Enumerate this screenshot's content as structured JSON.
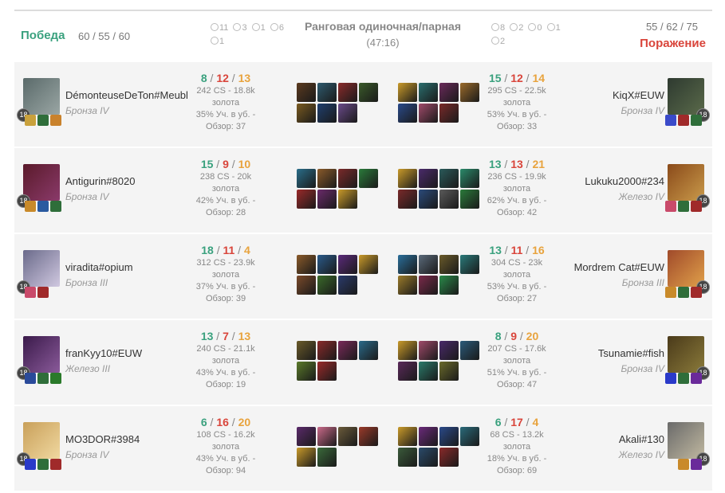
{
  "header": {
    "win_label": "Победа",
    "win_score": "60 / 55 / 60",
    "loss_label": "Поражение",
    "loss_score": "55 / 62 / 75",
    "queue_title": "Ранговая одиночная/парная",
    "duration": "(47:16)",
    "blue_objectives": {
      "towers": "11",
      "inhibitors": "3",
      "barons": "1",
      "dragons": "6",
      "heralds": "1"
    },
    "red_objectives": {
      "towers": "8",
      "inhibitors": "2",
      "barons": "0",
      "dragons": "1",
      "heralds": "2"
    }
  },
  "labels": {
    "gold": "золота"
  },
  "rows": [
    {
      "left": {
        "name": "DémonteuseDeTon#Meubl",
        "rank": "Бронза IV",
        "level": "18",
        "k": "8",
        "d": "12",
        "a": "13",
        "cs": "242 CS - 18.8k",
        "kp": "35% Уч. в уб. -",
        "vision": "Обзор: 37",
        "portrait_colors": [
          "#5a6a6a",
          "#9aa6a4"
        ],
        "rune_colors": [
          "#c9a13c",
          "#2f6e3a",
          "#c9822c"
        ],
        "item_colors": [
          "#5b3a1f",
          "#2e5a6e",
          "#8a2b2b",
          "#3a5a2a",
          "#7a5a20",
          "#1f3f6e",
          "#6a4a8a"
        ]
      },
      "right": {
        "name": "KiqX#EUW",
        "rank": "Бронза IV",
        "level": "18",
        "k": "15",
        "d": "12",
        "a": "14",
        "cs": "295 CS - 22.5k",
        "kp": "53% Уч. в уб. -",
        "vision": "Обзор: 33",
        "portrait_colors": [
          "#2e3a30",
          "#5a6a4a"
        ],
        "rune_colors": [
          "#3a4ac9",
          "#a02a2a",
          "#2f6e3a"
        ],
        "item_colors": [
          "#c99a2a",
          "#2a6e6e",
          "#6a2a5a",
          "#9a6a2a",
          "#2a4a8a",
          "#a04a6a",
          "#7a2a2a"
        ]
      }
    },
    {
      "left": {
        "name": "Antigurin#8020",
        "rank": "Бронза IV",
        "level": "18",
        "k": "15",
        "d": "9",
        "a": "10",
        "cs": "238 CS - 20k",
        "kp": "42% Уч. в уб. -",
        "vision": "Обзор: 28",
        "portrait_colors": [
          "#5a1a2a",
          "#8a3a6a"
        ],
        "rune_colors": [
          "#c98a2a",
          "#2a5aa0",
          "#2f6e3a"
        ],
        "item_colors": [
          "#2a6e8a",
          "#8a5a2a",
          "#7a2a2a",
          "#2a7a3a",
          "#9a2a2a",
          "#6a2a6a",
          "#c99a2a"
        ]
      },
      "right": {
        "name": "Lukuku2000#234",
        "rank": "Железо IV",
        "level": "18",
        "k": "13",
        "d": "13",
        "a": "21",
        "cs": "236 CS - 19.9k",
        "kp": "62% Уч. в уб. -",
        "vision": "Обзор: 42",
        "portrait_colors": [
          "#8a4a1a",
          "#c99a4a"
        ],
        "rune_colors": [
          "#c94a6a",
          "#2f6e3a",
          "#a02a2a"
        ],
        "item_colors": [
          "#c99a2a",
          "#4a2a6a",
          "#2a5a5a",
          "#2a8a6a",
          "#7a2a2a",
          "#2a4a7a",
          "#5a5a5a",
          "#2a7a3a"
        ]
      }
    },
    {
      "left": {
        "name": "viradita#opium",
        "rank": "Бронза III",
        "level": "18",
        "k": "18",
        "d": "11",
        "a": "4",
        "cs": "312 CS - 23.9k",
        "kp": "37% Уч. в уб. -",
        "vision": "Обзор: 39",
        "portrait_colors": [
          "#6a6a8a",
          "#d0c8e0"
        ],
        "rune_colors": [
          "#c94a6a",
          "#a02a2a"
        ],
        "item_colors": [
          "#8a5a2a",
          "#2a5a8a",
          "#5a2a7a",
          "#c99a2a",
          "#7a4a2a",
          "#3a6a2a",
          "#2a3a6a"
        ]
      },
      "right": {
        "name": "Mordrem Cat#EUW",
        "rank": "Бронза III",
        "level": "18",
        "k": "13",
        "d": "11",
        "a": "16",
        "cs": "304 CS - 23k",
        "kp": "53% Уч. в уб. -",
        "vision": "Обзор: 27",
        "portrait_colors": [
          "#a04a2a",
          "#e0a04a"
        ],
        "rune_colors": [
          "#c98a2a",
          "#2f6e3a",
          "#a02a2a"
        ],
        "item_colors": [
          "#2a6e9a",
          "#5a6a7a",
          "#6a5a2a",
          "#2a7a7a",
          "#9a7a2a",
          "#7a2a4a",
          "#2a8a4a"
        ]
      }
    },
    {
      "left": {
        "name": "franKyy10#EUW",
        "rank": "Железо III",
        "level": "18",
        "k": "13",
        "d": "7",
        "a": "13",
        "cs": "240 CS - 21.1k",
        "kp": "43% Уч. в уб. -",
        "vision": "Обзор: 19",
        "portrait_colors": [
          "#3a1a4a",
          "#8a5a9a"
        ],
        "rune_colors": [
          "#2a4a9a",
          "#2f6e3a",
          "#2a7a2a"
        ],
        "item_colors": [
          "#6a5a2a",
          "#8a2a2a",
          "#7a2a5a",
          "#2a6a8a",
          "#5a7a2a",
          "#9a2a2a"
        ]
      },
      "right": {
        "name": "Tsunamie#fish",
        "rank": "Бронза IV",
        "level": "18",
        "k": "8",
        "d": "9",
        "a": "20",
        "cs": "207 CS - 17.6k",
        "kp": "51% Уч. в уб. -",
        "vision": "Обзор: 47",
        "portrait_colors": [
          "#4a3a1a",
          "#8a7a3a"
        ],
        "rune_colors": [
          "#2a3ac9",
          "#2f6e3a",
          "#6a2a9a"
        ],
        "item_colors": [
          "#c99a2a",
          "#a04a6a",
          "#4a2a6a",
          "#2a5a7a",
          "#5a2a5a",
          "#2a7a6a",
          "#6a6a2a"
        ]
      }
    },
    {
      "left": {
        "name": "MO3DOR#3984",
        "rank": "Бронза IV",
        "level": "18",
        "k": "6",
        "d": "16",
        "a": "20",
        "cs": "108 CS - 16.2k",
        "kp": "43% Уч. в уб. -",
        "vision": "Обзор: 94",
        "portrait_colors": [
          "#c9a05a",
          "#f0d8a0"
        ],
        "rune_colors": [
          "#2a3ac9",
          "#2f6e3a",
          "#a02a2a"
        ],
        "item_colors": [
          "#5a2a6a",
          "#c96a8a",
          "#6a5a3a",
          "#9a3a2a",
          "#c99a2a",
          "#3a6a3a"
        ]
      },
      "right": {
        "name": "Akali#130",
        "rank": "Железо IV",
        "level": "18",
        "k": "6",
        "d": "17",
        "a": "4",
        "cs": "68 CS - 13.2k",
        "kp": "18% Уч. в уб. -",
        "vision": "Обзор: 69",
        "portrait_colors": [
          "#6a6a6a",
          "#c0b8a0"
        ],
        "rune_colors": [
          "#c98a2a",
          "#6a2a9a"
        ],
        "item_colors": [
          "#c99a2a",
          "#6a2a7a",
          "#2a4a8a",
          "#2a6a7a",
          "#3a5a3a",
          "#2a4a6a",
          "#8a2a2a"
        ]
      }
    }
  ]
}
